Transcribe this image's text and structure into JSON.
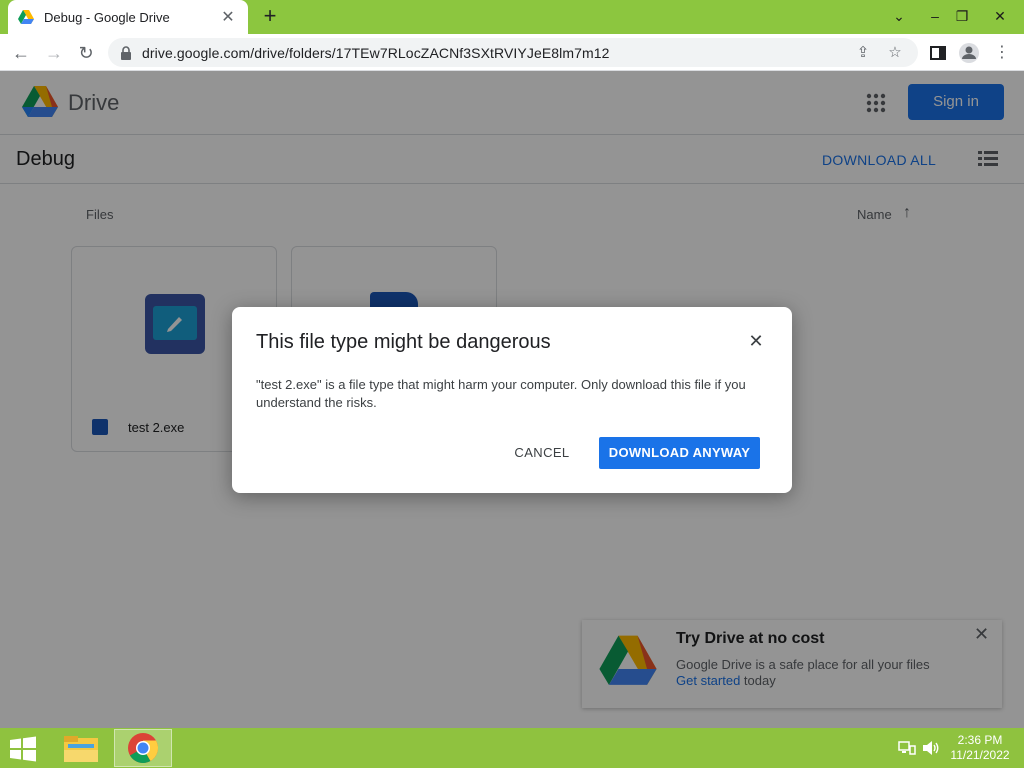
{
  "browser": {
    "tab_title": "Debug - Google Drive",
    "url": "drive.google.com/drive/folders/17TEw7RLocZACNf3SXtRVIYJeE8lm7m12"
  },
  "drive": {
    "wordmark": "Drive",
    "sign_in": "Sign in",
    "folder_title": "Debug",
    "download_all": "DOWNLOAD ALL",
    "files_label": "Files",
    "sort_label": "Name",
    "files": [
      {
        "name": "test 2.exe"
      }
    ]
  },
  "promo": {
    "title": "Try Drive at no cost",
    "text": "Google Drive is a safe place for all your files",
    "link": "Get started",
    "suffix": " today"
  },
  "dialog": {
    "title": "This file type might be dangerous",
    "body": "\"test 2.exe\" is a file type that might harm your computer. Only download this file if you understand the risks.",
    "cancel": "CANCEL",
    "confirm": "DOWNLOAD ANYWAY"
  },
  "taskbar": {
    "time": "2:36 PM",
    "date": "11/21/2022"
  },
  "colors": {
    "accent": "#1a73e8",
    "taskbar": "#8fc23f"
  }
}
